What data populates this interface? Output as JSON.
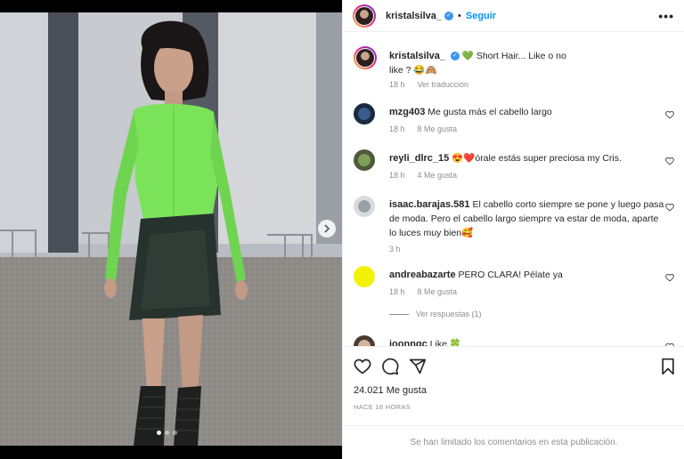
{
  "post": {
    "username": "kristalsilva_",
    "separator": "•",
    "follow_label": "Seguir",
    "more_label": "•••",
    "caption_text": "💚 Short Hair... Like o no like ? 😂🙈",
    "caption_time": "18 h",
    "caption_translate": "Ver traducción"
  },
  "comments": [
    {
      "username": "mzg403",
      "text": "Me gusta más el cabello largo",
      "time": "18 h",
      "likes": "8 Me gusta"
    },
    {
      "username": "reyli_dlrc_15",
      "text": "😍❤️órale estás super preciosa my Cris.",
      "time": "18 h",
      "likes": "4 Me gusta"
    },
    {
      "username": "isaac.barajas.581",
      "text": "El cabello corto siempre se pone y luego pasa de moda. Pero el cabello largo siempre va estar de moda, aparte lo luces muy bien🥰",
      "time": "3 h",
      "likes": ""
    },
    {
      "username": "andreabazarte",
      "text": "PERO CLARA! Pélate ya",
      "time": "18 h",
      "likes": "8 Me gusta"
    },
    {
      "username": "joonngc",
      "text": "Like 🍀",
      "time": "",
      "likes": ""
    }
  ],
  "view_replies": "Ver respuestas (1)",
  "likes_count": "24.021 Me gusta",
  "posted_ago": "HACE 18 HORAS",
  "comments_limited": "Se han limitado los comentarios en esta publicación.",
  "icons": {
    "like": "heart-icon",
    "comment": "comment-icon",
    "share": "share-icon",
    "save": "bookmark-icon",
    "verified": "verified-badge-icon",
    "next": "chevron-right-icon"
  },
  "colors": {
    "follow": "#0095f6",
    "verified": "#3897f0",
    "shirt": "#7be35a",
    "meta": "#8e8e8e"
  },
  "carousel": {
    "total": 3,
    "active": 1
  }
}
